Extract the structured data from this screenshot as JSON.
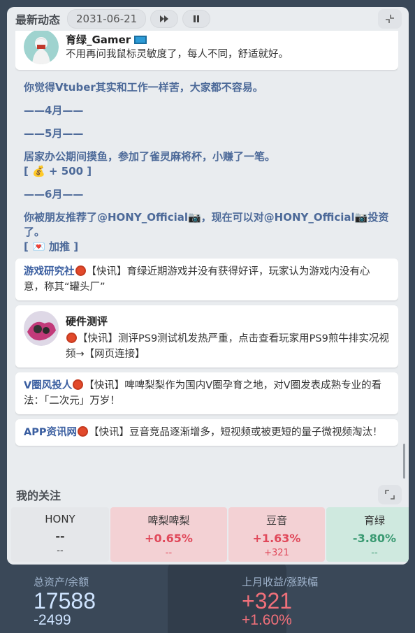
{
  "header": {
    "title": "最新动态",
    "date": "2031-06-21"
  },
  "feed": {
    "top_post": {
      "author": "育绿_Gamer",
      "text": "不用再问我鼠标灵敏度了，每人不同，舒适就好。"
    },
    "blue_lines": [
      "你觉得Vtuber其实和工作一样苦，大家都不容易。",
      "——4月——",
      "——5月——",
      "居家办公期间摸鱼，参加了雀灵麻将杯，小赚了一笔。",
      "[ 💰 + 500 ]",
      "——6月——",
      "你被朋友推荐了@HONY_Official📷，现在可以对@HONY_Official📷投资了。",
      "[ 💌 加推 ]"
    ],
    "news": [
      {
        "source": "游戏研究社",
        "tag": "【快讯】",
        "text": "育绿近期游戏并没有获得好评，玩家认为游戏内没有心意，称其“罐头厂”"
      },
      {
        "source": "硬件测评",
        "tag": "【快讯】",
        "text": "测评PS9测试机发热严重，点击查看玩家用PS9煎牛排实况视频→【网页连接】"
      },
      {
        "source": "V圈风投人",
        "tag": "【快讯】",
        "text": "啤啤梨梨作为国内V圈孕育之地，对V圈发表成熟专业的看法：「二次元」万岁！"
      },
      {
        "source": "APP资讯网",
        "tag": "【快讯】",
        "text": "豆音竞品逐渐增多，短视频或被更短的量子微视频淘汰！"
      }
    ]
  },
  "following": {
    "title": "我的关注",
    "stocks": [
      {
        "name": "HONY",
        "pct": "--",
        "sub": "--"
      },
      {
        "name": "啤梨啤梨",
        "pct": "+0.65%",
        "sub": "--"
      },
      {
        "name": "豆音",
        "pct": "+1.63%",
        "sub": "+321"
      },
      {
        "name": "育绿",
        "pct": "-3.80%",
        "sub": "--"
      }
    ]
  },
  "summary": {
    "assets_label": "总资产/余额",
    "assets": "17588",
    "balance": "-2499",
    "income_label": "上月收益/涨跌幅",
    "income": "+321",
    "income_pct": "+1.60%"
  },
  "colors": {
    "up": "#e0485a",
    "down": "#3a9a72",
    "blue_text": "#4d6a99",
    "summary_blue": "#cfe4ff",
    "summary_red": "#f0707a"
  }
}
